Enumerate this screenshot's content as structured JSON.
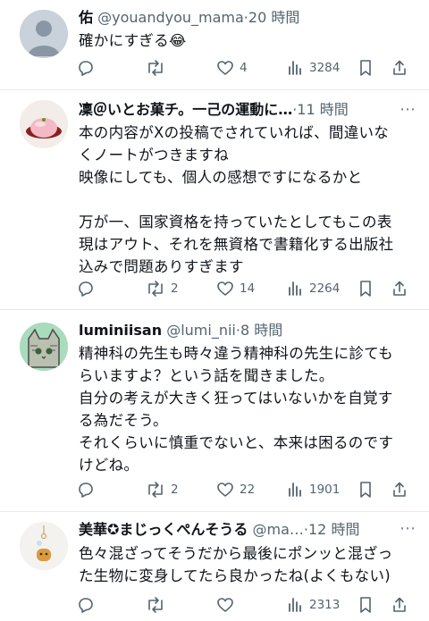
{
  "tweets": [
    {
      "name": "佑",
      "handle": "@youandyou_mama",
      "dot": "·",
      "time": "20 時間",
      "text": "確かにすぎる😂",
      "replies": "",
      "retweets": "",
      "likes": "4",
      "views": "3284",
      "avatar": "default-avatar"
    },
    {
      "name": "凜＠いとお菓チ。一己の運動に…",
      "handle": "",
      "dot": "·",
      "time": "11 時間",
      "text": "本の内容がXの投稿でされていれば、間違いな\nくノートがつきますね\n映像にしても、個人の感想ですになるかと\n\n万が一、国家資格を持っていたとしてもこの表\n現はアウト、それを無資格で書籍化する出版社\n込みで問題ありすぎます",
      "replies": "",
      "retweets": "2",
      "likes": "14",
      "views": "2264",
      "avatar": "wagashi-photo-avatar"
    },
    {
      "name": "luminiisan",
      "handle": "@lumi_nii",
      "dot": "·",
      "time": "8 時間",
      "text": "精神科の先生も時々違う精神科の先生に診ても\nらいますよ？という話を聞きました。\n自分の考えが大きく狂ってはいないかを自覚す\nる為だそう。\nそれくらいに慎重でないと、本来は困るのです\nけどね。",
      "replies": "",
      "retweets": "2",
      "likes": "22",
      "views": "1901",
      "avatar": "cat-illustration-avatar"
    },
    {
      "name": "美華✪まじっくぺんそうる",
      "handle": "@ma…",
      "dot": "·",
      "time": "12 時間",
      "text": "色々混ざってそうだから最後にポンッと混ざっ\nた生物に変身してたら良かったね(よくもない)",
      "replies": "",
      "retweets": "",
      "likes": "",
      "views": "2313",
      "avatar": "charm-photo-avatar"
    }
  ],
  "colors": {
    "text": "#0f1419",
    "secondary": "#536471",
    "divider": "#e6e9ec"
  }
}
